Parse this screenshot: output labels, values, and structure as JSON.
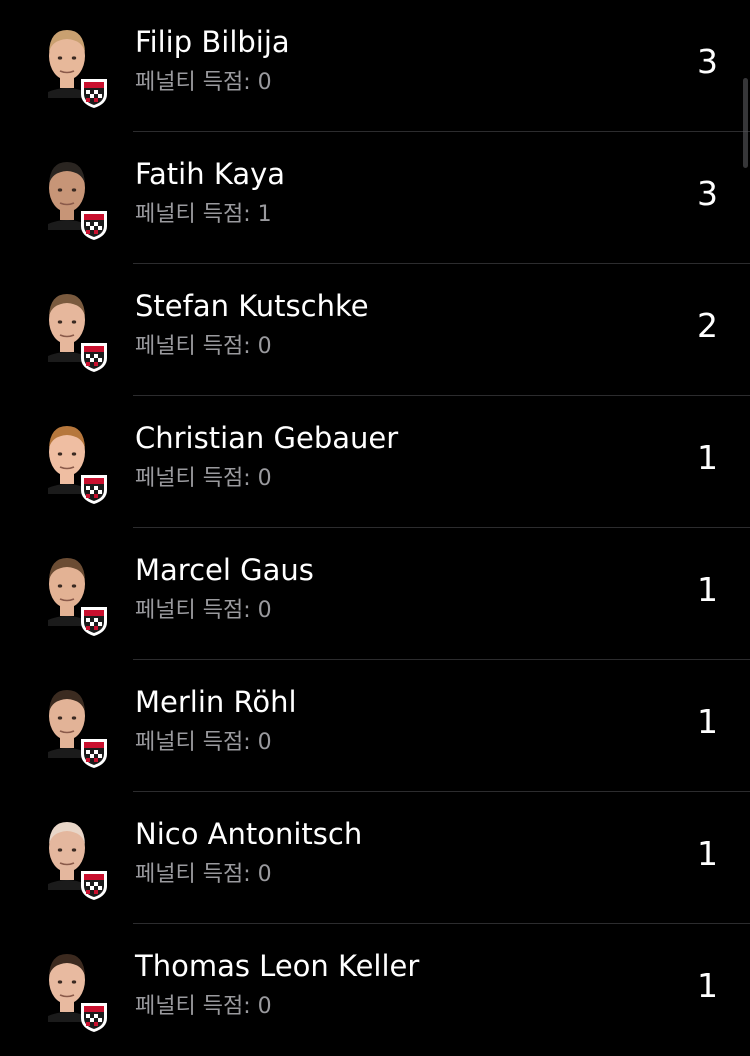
{
  "players": [
    {
      "name": "Filip Bilbija",
      "penalty_prefix": "페널티 득점:",
      "penalty_value": "0",
      "goals": "3",
      "skin": "#e7b89a",
      "hair": "#c9a070"
    },
    {
      "name": "Fatih Kaya",
      "penalty_prefix": "페널티 득점:",
      "penalty_value": "1",
      "goals": "3",
      "skin": "#c79577",
      "hair": "#2a2521"
    },
    {
      "name": "Stefan Kutschke",
      "penalty_prefix": "페널티 득점:",
      "penalty_value": "0",
      "goals": "2",
      "skin": "#e6b79c",
      "hair": "#7a5a3e"
    },
    {
      "name": "Christian Gebauer",
      "penalty_prefix": "페널티 득점:",
      "penalty_value": "0",
      "goals": "1",
      "skin": "#efbea2",
      "hair": "#b6773c"
    },
    {
      "name": "Marcel Gaus",
      "penalty_prefix": "페널티 득점:",
      "penalty_value": "0",
      "goals": "1",
      "skin": "#e3b294",
      "hair": "#6b4c33"
    },
    {
      "name": "Merlin Röhl",
      "penalty_prefix": "페널티 득점:",
      "penalty_value": "0",
      "goals": "1",
      "skin": "#e2b397",
      "hair": "#3b2b20"
    },
    {
      "name": "Nico Antonitsch",
      "penalty_prefix": "페널티 득점:",
      "penalty_value": "0",
      "goals": "1",
      "skin": "#e4b79e",
      "hair": "#e9d6c8"
    },
    {
      "name": "Thomas Leon Keller",
      "penalty_prefix": "페널티 득점:",
      "penalty_value": "0",
      "goals": "1",
      "skin": "#e8baa0",
      "hair": "#3c2a1f"
    }
  ],
  "colors": {
    "background": "#000000",
    "primary_text": "#ffffff",
    "secondary_text": "#9a9a9e",
    "divider": "#2c2c2e",
    "badge_red": "#c8102e",
    "badge_black": "#1b1b1b"
  }
}
